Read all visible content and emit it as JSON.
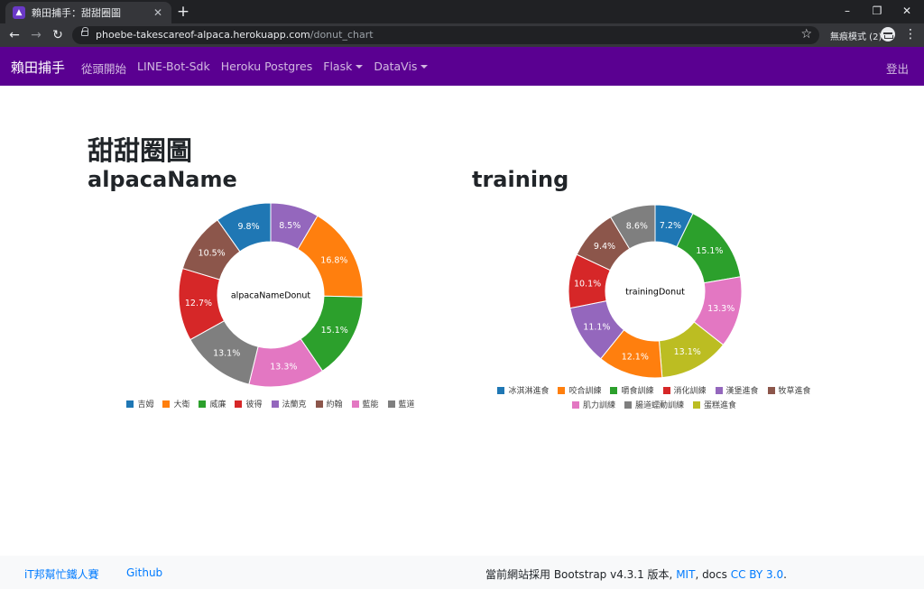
{
  "browser": {
    "tab_title": "賴田捕手：甜甜圈圖",
    "tab_favicon": "alpaca-favicon",
    "new_tab": "+",
    "url_host": "phoebe-takescareof-alpaca.herokuapp.com",
    "url_path": "/donut_chart",
    "incognito_label": "無痕模式 (2)",
    "window_controls": [
      "–",
      "❐",
      "✕"
    ]
  },
  "navbar": {
    "brand": "賴田捕手",
    "links": [
      {
        "label": "從頭開始",
        "dropdown": false
      },
      {
        "label": "LINE-Bot-Sdk",
        "dropdown": false
      },
      {
        "label": "Heroku Postgres",
        "dropdown": false
      },
      {
        "label": "Flask",
        "dropdown": true
      },
      {
        "label": "DataVis",
        "dropdown": true
      }
    ],
    "logout": "登出",
    "color": "#5a0091"
  },
  "page": {
    "title": "甜甜圈圖"
  },
  "chart_data": [
    {
      "type": "pie",
      "title": "alpacaName",
      "center_label": "alpacaNameDonut",
      "categories": [
        "吉姆",
        "大衛",
        "威廉",
        "彼得",
        "法蘭克",
        "約翰",
        "藍能",
        "藍道"
      ],
      "values": [
        9.8,
        16.8,
        15.1,
        12.7,
        8.5,
        10.5,
        13.3,
        13.1
      ],
      "labels": [
        "9.8%",
        "16.8%",
        "15.1%",
        "12.7%",
        "8.5%",
        "10.5%",
        "13.3%",
        "13.1%"
      ],
      "colors": [
        "#1f77b4",
        "#ff7f0e",
        "#2ca02c",
        "#d62728",
        "#9467bd",
        "#8c564b",
        "#e377c2",
        "#7f7f7f"
      ],
      "draw_order": [
        4,
        1,
        2,
        6,
        7,
        3,
        5,
        0
      ],
      "legend": "bottom"
    },
    {
      "type": "pie",
      "title": "training",
      "center_label": "trainingDonut",
      "categories": [
        "冰淇淋進食",
        "咬合訓練",
        "嚼食訓練",
        "消化訓練",
        "漢堡進食",
        "牧草進食",
        "肌力訓練",
        "腸道蠕動訓練",
        "蛋糕進食"
      ],
      "values": [
        7.2,
        12.1,
        15.1,
        10.1,
        11.1,
        9.4,
        13.3,
        8.6,
        13.1
      ],
      "labels": [
        "7.2%",
        "12.1%",
        "15.1%",
        "10.1%",
        "11.1%",
        "9.4%",
        "13.3%",
        "8.6%",
        "13.1%"
      ],
      "colors": [
        "#1f77b4",
        "#ff7f0e",
        "#2ca02c",
        "#d62728",
        "#9467bd",
        "#8c564b",
        "#e377c2",
        "#7f7f7f",
        "#bcbd22"
      ],
      "draw_order": [
        0,
        2,
        6,
        8,
        1,
        4,
        3,
        5,
        7
      ],
      "legend": "bottom"
    }
  ],
  "footer": {
    "link1": "iT邦幫忙鐵人賽",
    "link2": "Github",
    "text_prefix": "當前網站採用 Bootstrap v4.3.1 版本, ",
    "mit": "MIT",
    "text_mid": ", docs ",
    "cc": "CC BY 3.0",
    "text_suffix": "."
  }
}
